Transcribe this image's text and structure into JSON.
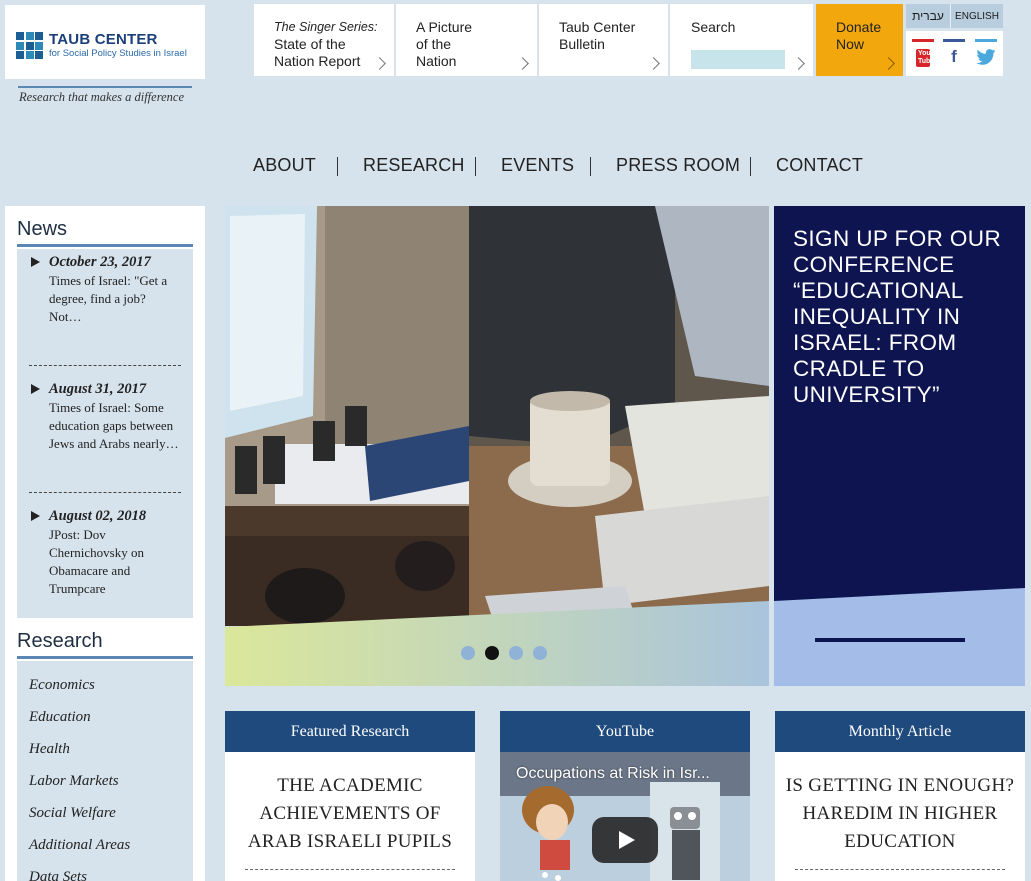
{
  "logo": {
    "title": "TAUB CENTER",
    "subtitle": "for Social Policy Studies in Israel",
    "tagline": "Research that makes a difference"
  },
  "top_tiles": {
    "singer_series_em": "The Singer Series:",
    "singer_series_line1": "State of the",
    "singer_series_line2": "Nation Report",
    "picture_line1": "A Picture",
    "picture_line2": "of the",
    "picture_line3": "Nation",
    "bulletin_line1": "Taub Center",
    "bulletin_line2": "Bulletin",
    "search_label": "Search",
    "search_value": "",
    "donate_line1": "Donate",
    "donate_line2": "Now"
  },
  "languages": {
    "hebrew": "עברית",
    "english": "ENGLISH"
  },
  "social": {
    "youtube_icon": "youtube-icon",
    "youtube_glyph_top": "You",
    "youtube_glyph_bottom": "Tube",
    "facebook_icon": "facebook-icon",
    "facebook_glyph": "f",
    "twitter_icon": "twitter-icon"
  },
  "nav": [
    "ABOUT",
    "RESEARCH",
    "EVENTS",
    "PRESS ROOM",
    "CONTACT"
  ],
  "sidebar": {
    "news_title": "News",
    "news": [
      {
        "date": "October 23, 2017",
        "text": "Times of Israel: \"Get a degree, find a job? Not…"
      },
      {
        "date": "August 31, 2017",
        "text": "Times of Israel: Some education gaps between Jews and Arabs nearly…"
      },
      {
        "date": "August 02, 2018",
        "text": "JPost: Dov Chernichovsky on Obamacare and Trumpcare"
      }
    ],
    "research_title": "Research",
    "research_links": [
      "Economics",
      "Education",
      "Health",
      "Labor Markets",
      "Social Welfare",
      "Additional Areas",
      "Data Sets"
    ]
  },
  "hero": {
    "slide_count": 4,
    "active_slide": 2,
    "promo_text": "SIGN UP FOR OUR CONFERENCE “EDUCATIONAL INEQUALITY IN ISRAEL: FROM CRADLE TO UNIVERSITY”"
  },
  "cards": {
    "featured_head": "Featured Research",
    "featured_title": "THE ACADEMIC ACHIEVEMENTS OF ARAB ISRAELI PUPILS",
    "youtube_head": "YouTube",
    "youtube_video_title": "Occupations at Risk in Isr...",
    "monthly_head": "Monthly Article",
    "monthly_title": "IS GETTING IN ENOUGH? HAREDIM IN HIGHER EDUCATION"
  },
  "colors": {
    "page_bg": "#d6e3ec",
    "brand_blue": "#1f4a7d",
    "donate_orange": "#f2a70d",
    "promo_navy": "#0d1450",
    "promo_light": "#a3bce8"
  }
}
